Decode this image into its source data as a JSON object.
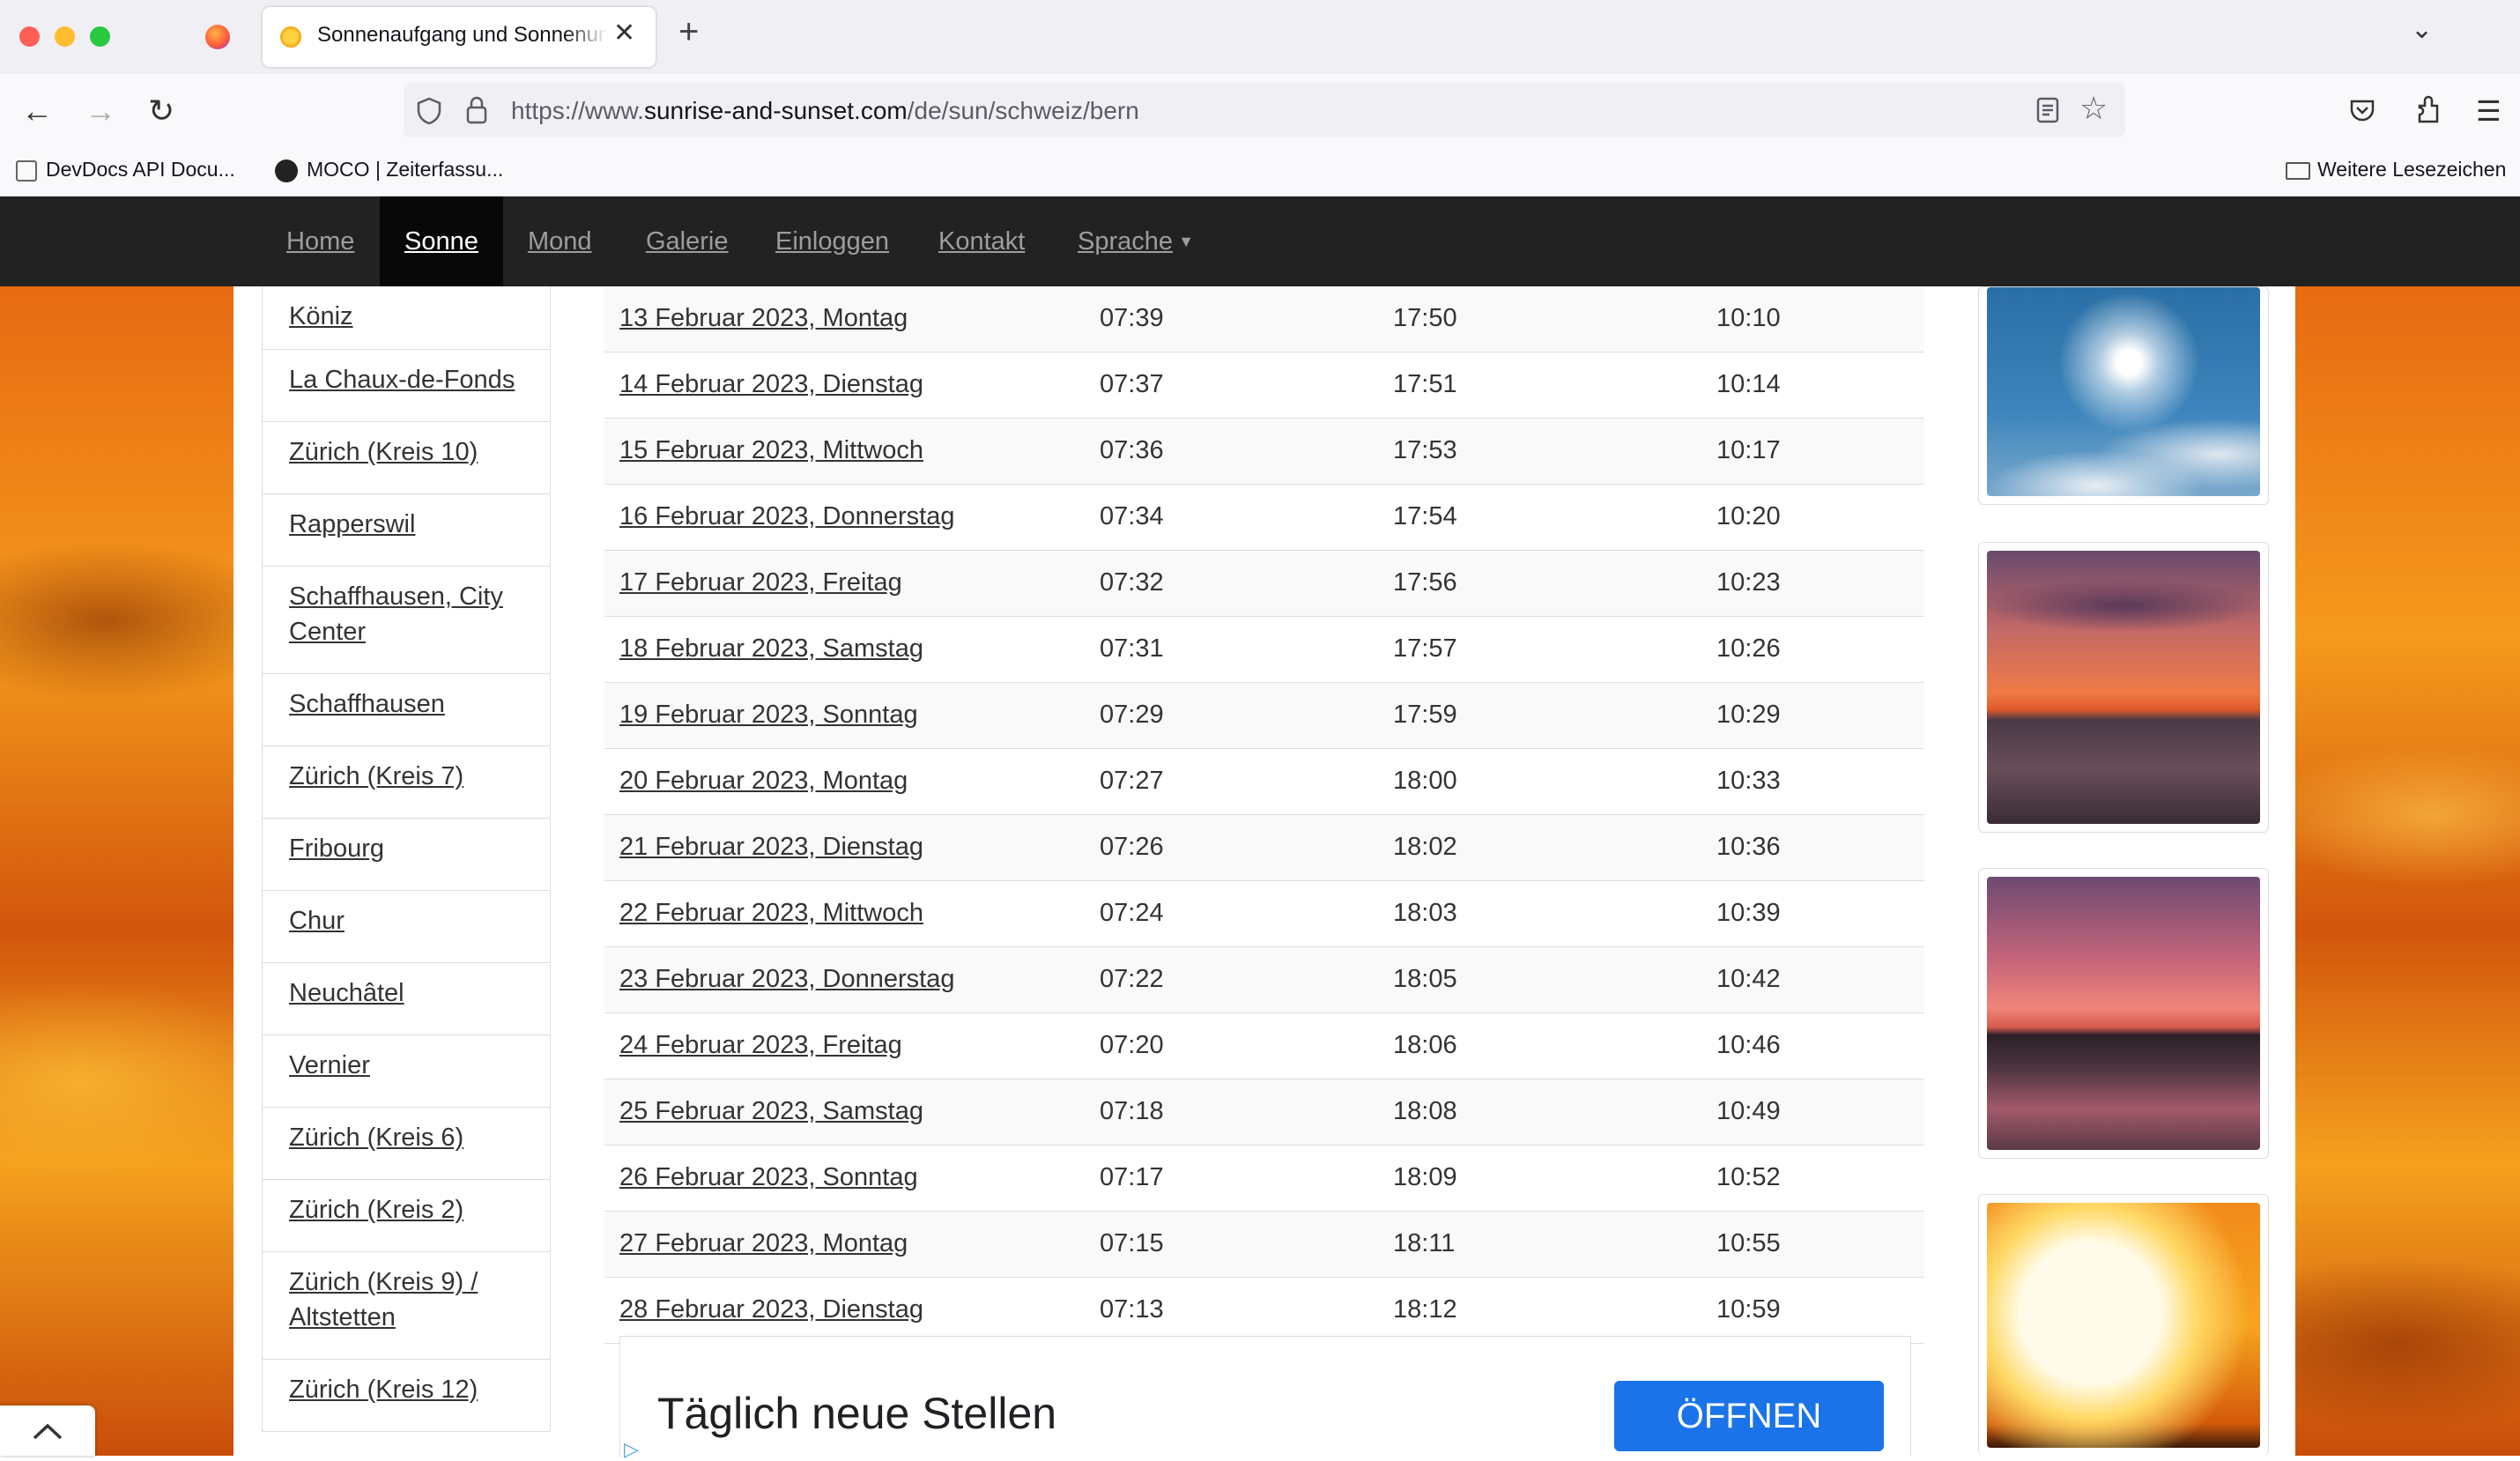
{
  "browser": {
    "tab_title": "Sonnenaufgang und Sonnenuntergang",
    "url_prefix": "https://www.",
    "url_host": "sunrise-and-sunset.com",
    "url_path": "/de/sun/schweiz/bern",
    "bookmarks": [
      "DevDocs API Docu...",
      "MOCO | Zeiterfassu..."
    ],
    "bookmarks_folder": "Weitere Lesezeichen"
  },
  "nav": {
    "items": [
      "Home",
      "Sonne",
      "Mond",
      "Galerie",
      "Einloggen",
      "Kontakt",
      "Sprache"
    ],
    "active": "Sonne"
  },
  "sidebar": {
    "items": [
      "Köniz",
      "La Chaux-de-Fonds",
      "Zürich (Kreis 10)",
      "Rapperswil",
      "Schaffhausen, City Center",
      "Schaffhausen",
      "Zürich (Kreis 7)",
      "Fribourg",
      "Chur",
      "Neuchâtel",
      "Vernier",
      "Zürich (Kreis 6)",
      "Zürich (Kreis 2)",
      "Zürich (Kreis 9) / Altstetten",
      "Zürich (Kreis 12)"
    ]
  },
  "table": {
    "rows": [
      {
        "date": "13 Februar 2023, Montag",
        "sunrise": "07:39",
        "sunset": "17:50",
        "day_length": "10:10"
      },
      {
        "date": "14 Februar 2023, Dienstag",
        "sunrise": "07:37",
        "sunset": "17:51",
        "day_length": "10:14"
      },
      {
        "date": "15 Februar 2023, Mittwoch",
        "sunrise": "07:36",
        "sunset": "17:53",
        "day_length": "10:17"
      },
      {
        "date": "16 Februar 2023, Donnerstag",
        "sunrise": "07:34",
        "sunset": "17:54",
        "day_length": "10:20"
      },
      {
        "date": "17 Februar 2023, Freitag",
        "sunrise": "07:32",
        "sunset": "17:56",
        "day_length": "10:23"
      },
      {
        "date": "18 Februar 2023, Samstag",
        "sunrise": "07:31",
        "sunset": "17:57",
        "day_length": "10:26"
      },
      {
        "date": "19 Februar 2023, Sonntag",
        "sunrise": "07:29",
        "sunset": "17:59",
        "day_length": "10:29"
      },
      {
        "date": "20 Februar 2023, Montag",
        "sunrise": "07:27",
        "sunset": "18:00",
        "day_length": "10:33"
      },
      {
        "date": "21 Februar 2023, Dienstag",
        "sunrise": "07:26",
        "sunset": "18:02",
        "day_length": "10:36"
      },
      {
        "date": "22 Februar 2023, Mittwoch",
        "sunrise": "07:24",
        "sunset": "18:03",
        "day_length": "10:39"
      },
      {
        "date": "23 Februar 2023, Donnerstag",
        "sunrise": "07:22",
        "sunset": "18:05",
        "day_length": "10:42"
      },
      {
        "date": "24 Februar 2023, Freitag",
        "sunrise": "07:20",
        "sunset": "18:06",
        "day_length": "10:46"
      },
      {
        "date": "25 Februar 2023, Samstag",
        "sunrise": "07:18",
        "sunset": "18:08",
        "day_length": "10:49"
      },
      {
        "date": "26 Februar 2023, Sonntag",
        "sunrise": "07:17",
        "sunset": "18:09",
        "day_length": "10:52"
      },
      {
        "date": "27 Februar 2023, Montag",
        "sunrise": "07:15",
        "sunset": "18:11",
        "day_length": "10:55"
      },
      {
        "date": "28 Februar 2023, Dienstag",
        "sunrise": "07:13",
        "sunset": "18:12",
        "day_length": "10:59"
      }
    ]
  },
  "ad": {
    "text": "Täglich neue Stellen",
    "button": "ÖFFNEN"
  },
  "colors": {
    "nav_bg": "#222222",
    "ad_button": "#1a73e8"
  }
}
